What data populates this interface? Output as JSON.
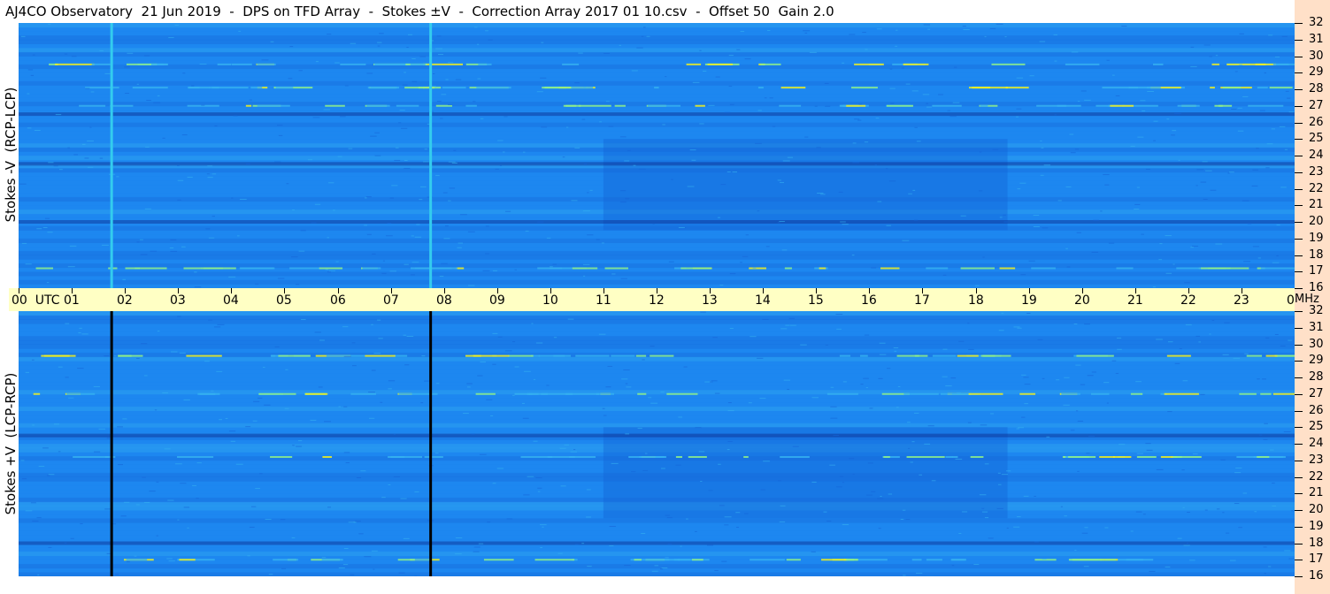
{
  "title": "AJ4CO Observatory  21 Jun 2019  -  DPS on TFD Array  -  Stokes ±V  -  Correction Array 2017 01 10.csv  -  Offset 50  Gain 2.0",
  "chart_data": [
    {
      "type": "heatmap",
      "panel": "top",
      "ylabel": "Stokes -V  (RCP-LCP)",
      "x_unit": "UTC",
      "y_unit": "MHz",
      "xlim": [
        0,
        24
      ],
      "ylim": [
        16,
        32
      ],
      "colormap": [
        "#0a2a8c",
        "#1565d8",
        "#1e88f0",
        "#35b0f0",
        "#8ef08a",
        "#f0f020"
      ],
      "features": {
        "vertical_lines_utc": [
          1.75,
          7.75
        ],
        "vertical_line_color": "#33ccee",
        "bright_bands_mhz": [
          17.2,
          27.0,
          28.1,
          29.5
        ],
        "dark_bands_mhz": [
          20.0,
          23.5,
          26.5
        ]
      }
    },
    {
      "type": "heatmap",
      "panel": "bottom",
      "ylabel": "Stokes +V  (LCP-RCP)",
      "x_unit": "UTC",
      "y_unit": "MHz",
      "xlim": [
        0,
        24
      ],
      "ylim": [
        16,
        32
      ],
      "colormap": [
        "#0a2a8c",
        "#1565d8",
        "#1e88f0",
        "#35b0f0",
        "#8ef08a",
        "#f0f020"
      ],
      "features": {
        "vertical_lines_utc": [
          1.75,
          7.75
        ],
        "vertical_line_color": "#000000",
        "bright_bands_mhz": [
          27.0,
          23.2,
          17.0,
          29.3
        ],
        "dark_bands_mhz": [
          18.0,
          24.5
        ]
      }
    }
  ],
  "time_axis": {
    "labels": [
      "00  UTC",
      "01",
      "02",
      "03",
      "04",
      "05",
      "06",
      "07",
      "08",
      "09",
      "10",
      "11",
      "12",
      "13",
      "14",
      "15",
      "16",
      "17",
      "18",
      "19",
      "20",
      "21",
      "22",
      "23",
      "00"
    ],
    "end_unit": "MHz"
  },
  "freq_axis": {
    "labels": [
      "32",
      "31",
      "30",
      "29",
      "28",
      "27",
      "26",
      "25",
      "24",
      "23",
      "22",
      "21",
      "20",
      "19",
      "18",
      "17",
      "16"
    ]
  }
}
